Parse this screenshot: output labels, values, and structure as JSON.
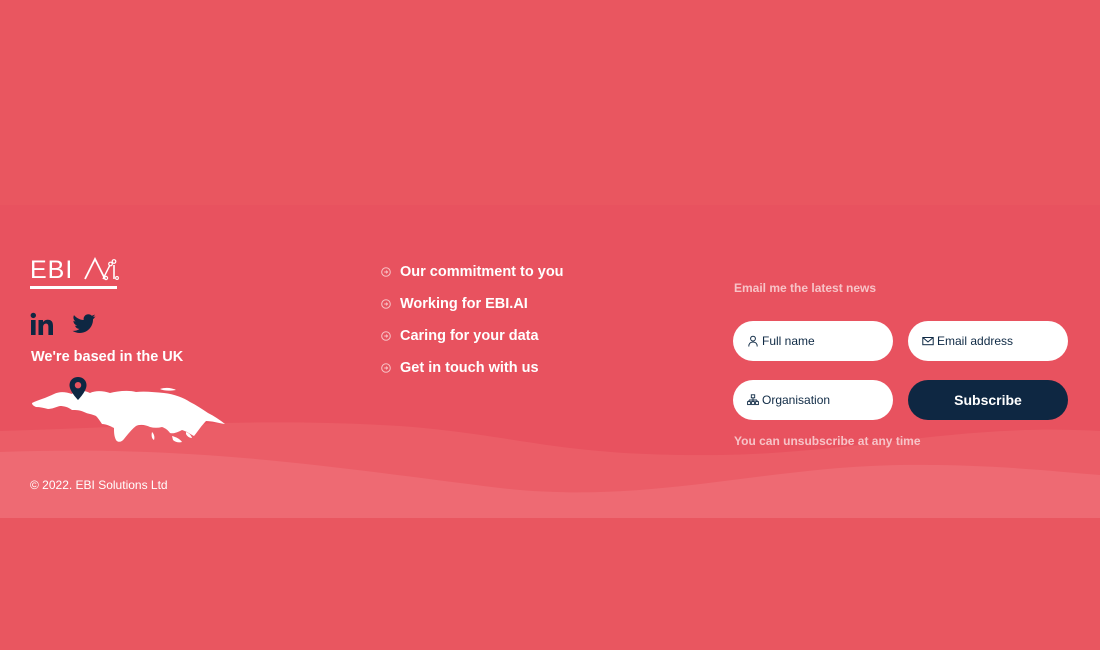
{
  "brand": {
    "logo_text": "EBI",
    "logo_icon": "ai-circuit-logo"
  },
  "colors": {
    "background": "#e95560",
    "footer": "#e8525f",
    "wave_light": "#ee6a73",
    "navy": "#0e2742",
    "muted_text": "#f7c3c7",
    "white": "#ffffff"
  },
  "social": {
    "items": [
      {
        "name": "linkedin-icon"
      },
      {
        "name": "twitter-icon"
      }
    ]
  },
  "location": {
    "label": "We're based in the UK",
    "map_icon": "world-map",
    "pin_icon": "map-pin-icon"
  },
  "links": [
    {
      "label": "Our commitment to you"
    },
    {
      "label": "Working for EBI.AI"
    },
    {
      "label": "Caring for your data"
    },
    {
      "label": "Get in touch with us"
    }
  ],
  "newsletter": {
    "heading": "Email me the latest news",
    "full_name_placeholder": "Full name",
    "email_placeholder": "Email address",
    "organisation_placeholder": "Organisation",
    "subscribe_label": "Subscribe",
    "note": "You can unsubscribe at any time"
  },
  "footer": {
    "copyright": "© 2022. EBI Solutions Ltd"
  }
}
